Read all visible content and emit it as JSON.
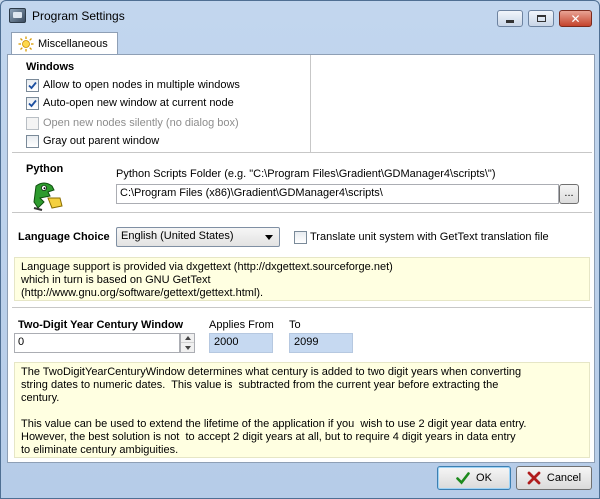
{
  "window": {
    "title": "Program Settings"
  },
  "tabs": [
    {
      "label": "Miscellaneous",
      "icon": "sun-icon"
    }
  ],
  "windows_section": {
    "heading": "Windows",
    "options": [
      {
        "label": "Allow to open nodes in multiple windows",
        "checked": true,
        "enabled": true
      },
      {
        "label": "Auto-open new window at current node",
        "checked": true,
        "enabled": true
      },
      {
        "label": "Open new nodes silently (no dialog box)",
        "checked": false,
        "enabled": false
      },
      {
        "label": "Gray out parent window",
        "checked": false,
        "enabled": true
      }
    ]
  },
  "python_section": {
    "heading": "Python",
    "folder_label": "Python Scripts Folder (e.g. \"C:\\Program Files\\Gradient\\GDManager4\\scripts\\\")",
    "folder_value": "C:\\Program Files (x86)\\Gradient\\GDManager4\\scripts\\",
    "browse_label": "..."
  },
  "language_section": {
    "heading": "Language Choice",
    "selected": "English (United States)",
    "translate_label": "Translate unit system with GetText translation file",
    "translate_checked": false,
    "info": "Language support is provided via dxgettext (http://dxgettext.sourceforge.net)\nwhich in turn is based on GNU GetText\n(http://www.gnu.org/software/gettext/gettext.html)."
  },
  "year_section": {
    "heading": "Two-Digit Year Century Window",
    "value": "0",
    "applies_from_label": "Applies From",
    "applies_from_value": "2000",
    "to_label": "To",
    "to_value": "2099",
    "info": "The TwoDigitYearCenturyWindow determines what century is added to two digit years when converting\nstring dates to numeric dates.  This value is  subtracted from the current year before extracting the\ncentury.\n\nThis value can be used to extend the lifetime of the application if you  wish to use 2 digit year data entry.\nHowever, the best solution is not  to accept 2 digit years at all, but to require 4 digit years in data entry\nto eliminate century ambiguities."
  },
  "buttons": {
    "ok": "OK",
    "cancel": "Cancel"
  },
  "colors": {
    "check_accent": "#1c4fa0",
    "info_bg": "#ffffe1",
    "readonly_bg": "#c6d9f1"
  }
}
